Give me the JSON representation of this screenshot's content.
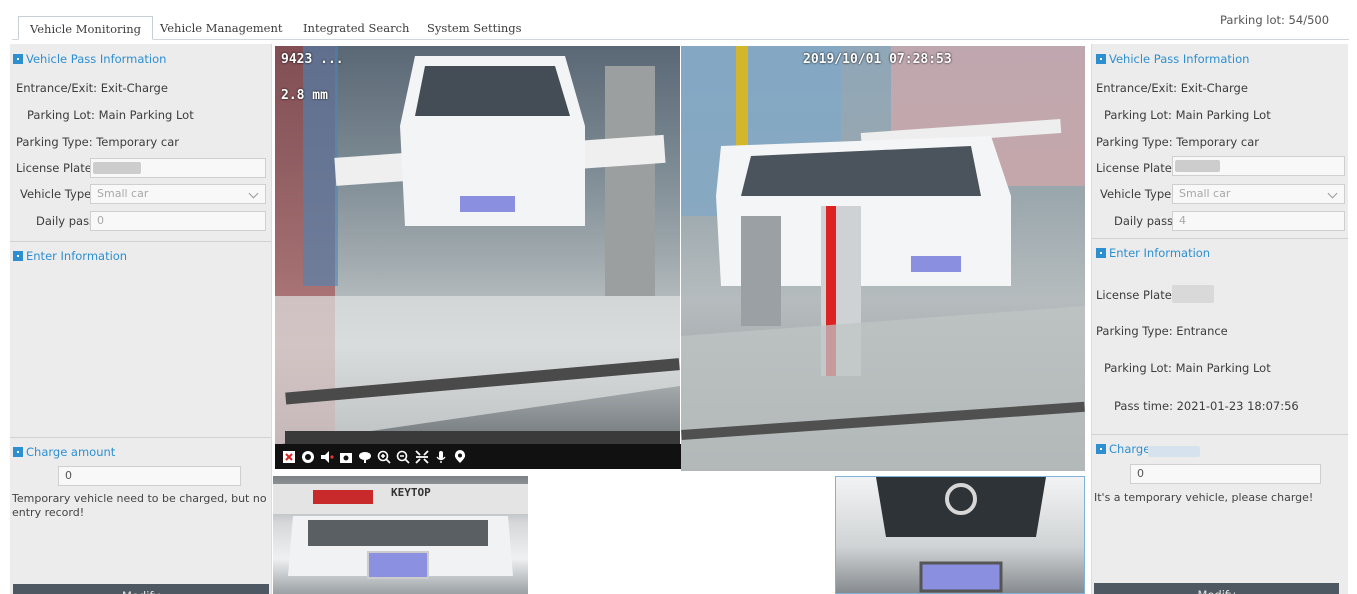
{
  "tabs": {
    "monitoring": "Vehicle Monitoring",
    "management": "Vehicle Management",
    "search": "Integrated Search",
    "settings": "System Settings"
  },
  "parking_status": "Parking lot: 54/500",
  "left": {
    "pass_title": "Vehicle Pass Information",
    "entrance_exit": "Entrance/Exit: Exit-Charge",
    "parking_lot": "Parking Lot: Main Parking Lot",
    "parking_type": "Parking Type: Temporary car",
    "plate_label": "License Plate:",
    "vehicle_type_label": "Vehicle Type:",
    "vehicle_type_value": "Small car",
    "daily_pass_label": "Daily pass:",
    "daily_pass_value": "0",
    "enter_title": "Enter Information",
    "charge_title": "Charge amount",
    "charge_value": "0",
    "message": "Temporary vehicle need to be charged, but no entry record!",
    "modify": "Modify"
  },
  "right": {
    "pass_title": "Vehicle Pass Information",
    "entrance_exit": "Entrance/Exit: Exit-Charge",
    "parking_lot": "Parking Lot: Main Parking Lot",
    "parking_type": "Parking Type: Temporary car",
    "plate_label": "License Plate:",
    "vehicle_type_label": "Vehicle Type:",
    "vehicle_type_value": "Small car",
    "daily_pass_label": "Daily pass:",
    "daily_pass_value": "4",
    "enter_title": "Enter Information",
    "enter_plate_label": "License Plate",
    "enter_parking_type": "Parking Type: Entrance",
    "enter_parking_lot": "Parking Lot: Main Parking Lot",
    "pass_time": "Pass time: 2021-01-23 18:07:56",
    "charge_title": "Charge",
    "charge_value": "0",
    "message": "It's a temporary vehicle, please charge!",
    "modify": "Modify"
  },
  "cameras": {
    "cam1_osd_top": "9423 ...",
    "cam1_osd_zoom": "2.8 mm",
    "cam2_osd_timestamp": "2019/10/01 07:28:53",
    "barrier_brand": "KEYTOP"
  },
  "toolbar_icons": [
    "close-icon",
    "record-icon",
    "audio-icon",
    "snapshot-icon",
    "talk-icon",
    "zoom-in-icon",
    "zoom-out-icon",
    "fullscreen-icon",
    "microphone-icon",
    "location-icon"
  ]
}
